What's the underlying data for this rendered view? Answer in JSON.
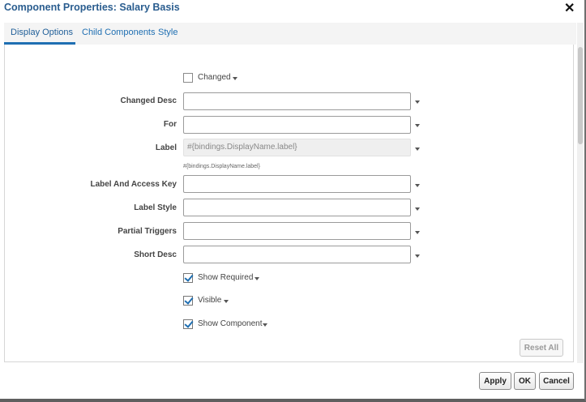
{
  "dialog": {
    "title": "Component Properties: Salary Basis",
    "close_symbol": "✕"
  },
  "tabs": [
    {
      "label": "Display Options",
      "active": true
    },
    {
      "label": "Child Components",
      "active": false
    },
    {
      "label": "Style",
      "active": false
    }
  ],
  "form": {
    "changed": {
      "label": "Changed",
      "checked": false
    },
    "changed_desc": {
      "label": "Changed Desc",
      "value": ""
    },
    "for": {
      "label": "For",
      "value": ""
    },
    "label": {
      "label": "Label",
      "value": "#{bindings.DisplayName.label}",
      "hint": "#{bindings.DisplayName.label}"
    },
    "label_access_key": {
      "label": "Label And Access Key",
      "value": ""
    },
    "label_style": {
      "label": "Label Style",
      "value": ""
    },
    "partial_triggers": {
      "label": "Partial Triggers",
      "value": ""
    },
    "short_desc": {
      "label": "Short Desc",
      "value": ""
    },
    "show_required": {
      "label": "Show Required",
      "checked": true
    },
    "visible": {
      "label": "Visible",
      "checked": true
    },
    "show_component": {
      "label": "Show Component",
      "checked": true
    }
  },
  "buttons": {
    "reset_all": "Reset All",
    "apply": "Apply",
    "ok": "OK",
    "cancel": "Cancel"
  },
  "colors": {
    "title": "#2a5d8f",
    "accent": "#1f6fb2"
  }
}
